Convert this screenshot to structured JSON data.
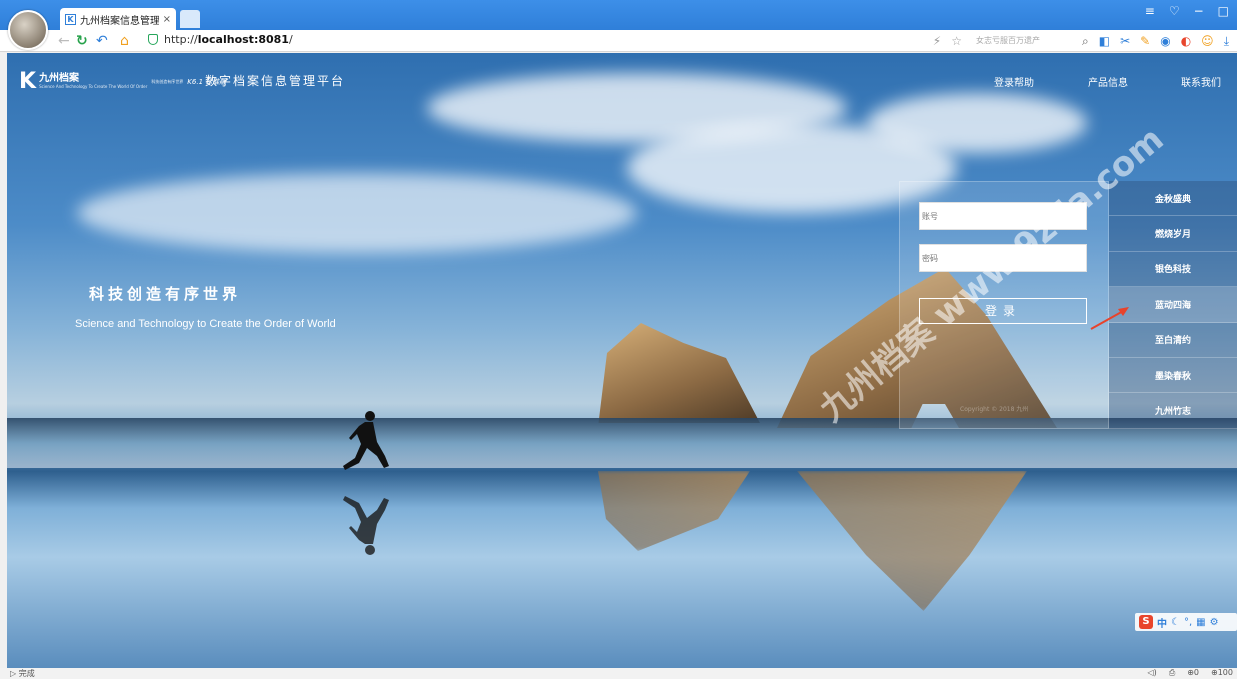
{
  "browser": {
    "tab_title": "九州档案信息管理平台",
    "tab_favicon": "K",
    "tab_close": "×",
    "url_prefix": "http://",
    "url_host": "localhost:8081",
    "url_suffix": "/",
    "search_placeholder": "女志亏服百万遗产",
    "window_controls": [
      "≡",
      "♡",
      "−",
      "□"
    ]
  },
  "header": {
    "logo_name": "九州档案",
    "logo_sub": "Science And Technology To Create The World Of Order",
    "logo_slogan": "科技创造有序世界",
    "logo_version": "K6.1 标准版",
    "platform_title": "数字档案信息管理平台",
    "nav": [
      "登录帮助",
      "产品信息",
      "联系我们"
    ]
  },
  "hero": {
    "slogan_cn": "科技创造有序世界",
    "slogan_en": "Science and Technology to Create the Order of World"
  },
  "login": {
    "account_placeholder": "账号",
    "password_placeholder": "密码",
    "submit_label": "登录",
    "copyright": "Copyright © 2018 九州"
  },
  "themes": [
    "金秋盛典",
    "燃烧岁月",
    "银色科技",
    "蓝动四海",
    "至白清约",
    "墨染春秋",
    "九州竹志"
  ],
  "active_theme_index": 3,
  "watermark": "九州档案 www.9zda.com",
  "ime": {
    "label": "中"
  },
  "status": {
    "text": "完成",
    "zoom": "100",
    "downloads": "0"
  },
  "colors": {
    "tab_bar": "#2f7fd9",
    "accent_arrow": "#e8432b"
  }
}
